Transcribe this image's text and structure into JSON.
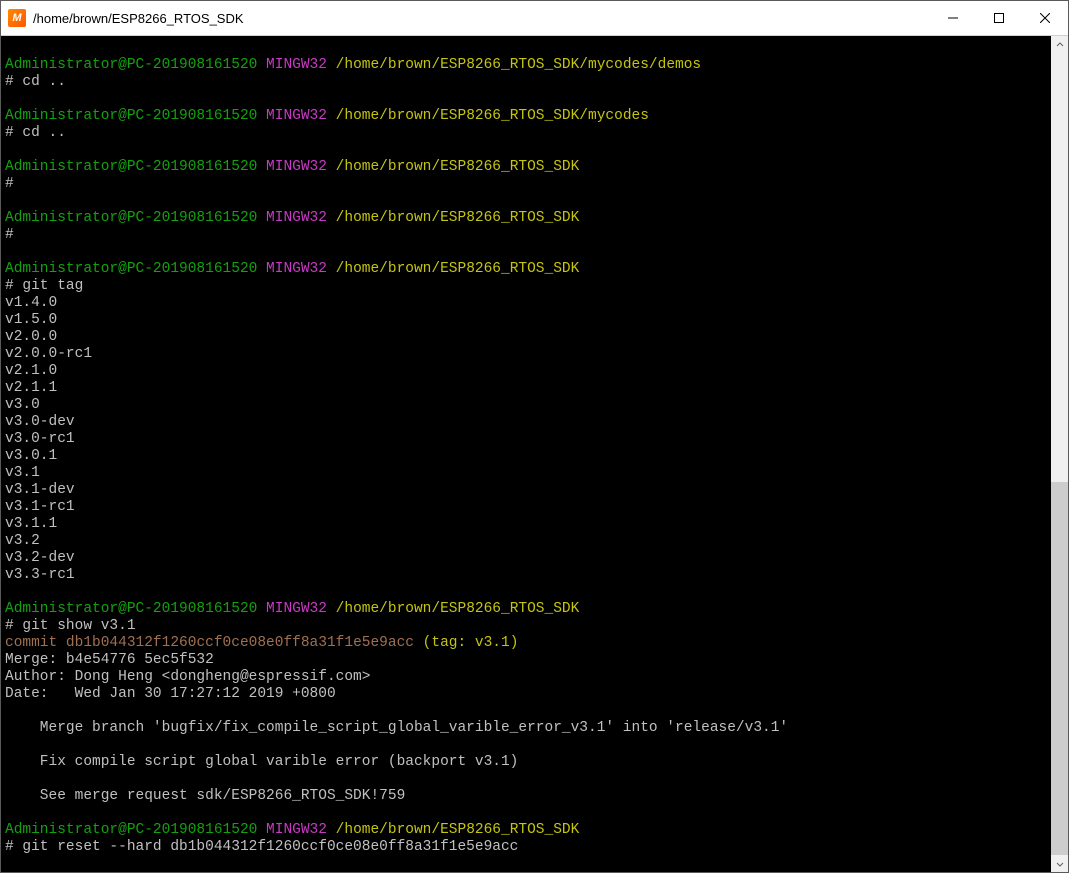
{
  "window": {
    "icon_letter": "M",
    "title": "/home/brown/ESP8266_RTOS_SDK"
  },
  "prompt": {
    "user_host": "Administrator@PC-201908161520",
    "env": "MINGW32",
    "char": "#"
  },
  "blocks": {
    "b1": {
      "path": "/home/brown/ESP8266_RTOS_SDK/mycodes/demos",
      "cmd": "cd .."
    },
    "b2": {
      "path": "/home/brown/ESP8266_RTOS_SDK/mycodes",
      "cmd": "cd .."
    },
    "b3": {
      "path": "/home/brown/ESP8266_RTOS_SDK",
      "cmd": ""
    },
    "b4": {
      "path": "/home/brown/ESP8266_RTOS_SDK",
      "cmd": ""
    },
    "b5": {
      "path": "/home/brown/ESP8266_RTOS_SDK",
      "cmd": "git tag"
    },
    "tags": [
      "v1.4.0",
      "v1.5.0",
      "v2.0.0",
      "v2.0.0-rc1",
      "v2.1.0",
      "v2.1.1",
      "v3.0",
      "v3.0-dev",
      "v3.0-rc1",
      "v3.0.1",
      "v3.1",
      "v3.1-dev",
      "v3.1-rc1",
      "v3.1.1",
      "v3.2",
      "v3.2-dev",
      "v3.3-rc1"
    ],
    "b6": {
      "path": "/home/brown/ESP8266_RTOS_SDK",
      "cmd": "git show v3.1"
    },
    "show": {
      "commit_label": "commit",
      "commit_hash": "db1b044312f1260ccf0ce08e0ff8a31f1e5e9acc",
      "ref_open": " (",
      "ref_tag_label": "tag: ",
      "ref_tag_name": "v3.1",
      "ref_close": ")",
      "merge": "Merge: b4e54776 5ec5f532",
      "author": "Author: Dong Heng <dongheng@espressif.com>",
      "date": "Date:   Wed Jan 30 17:27:12 2019 +0800",
      "msg1": "    Merge branch 'bugfix/fix_compile_script_global_varible_error_v3.1' into 'release/v3.1'",
      "msg2": "    Fix compile script global varible error (backport v3.1)",
      "msg3": "    See merge request sdk/ESP8266_RTOS_SDK!759"
    },
    "b7": {
      "path": "/home/brown/ESP8266_RTOS_SDK",
      "cmd": "git reset --hard db1b044312f1260ccf0ce08e0ff8a31f1e5e9acc"
    }
  }
}
